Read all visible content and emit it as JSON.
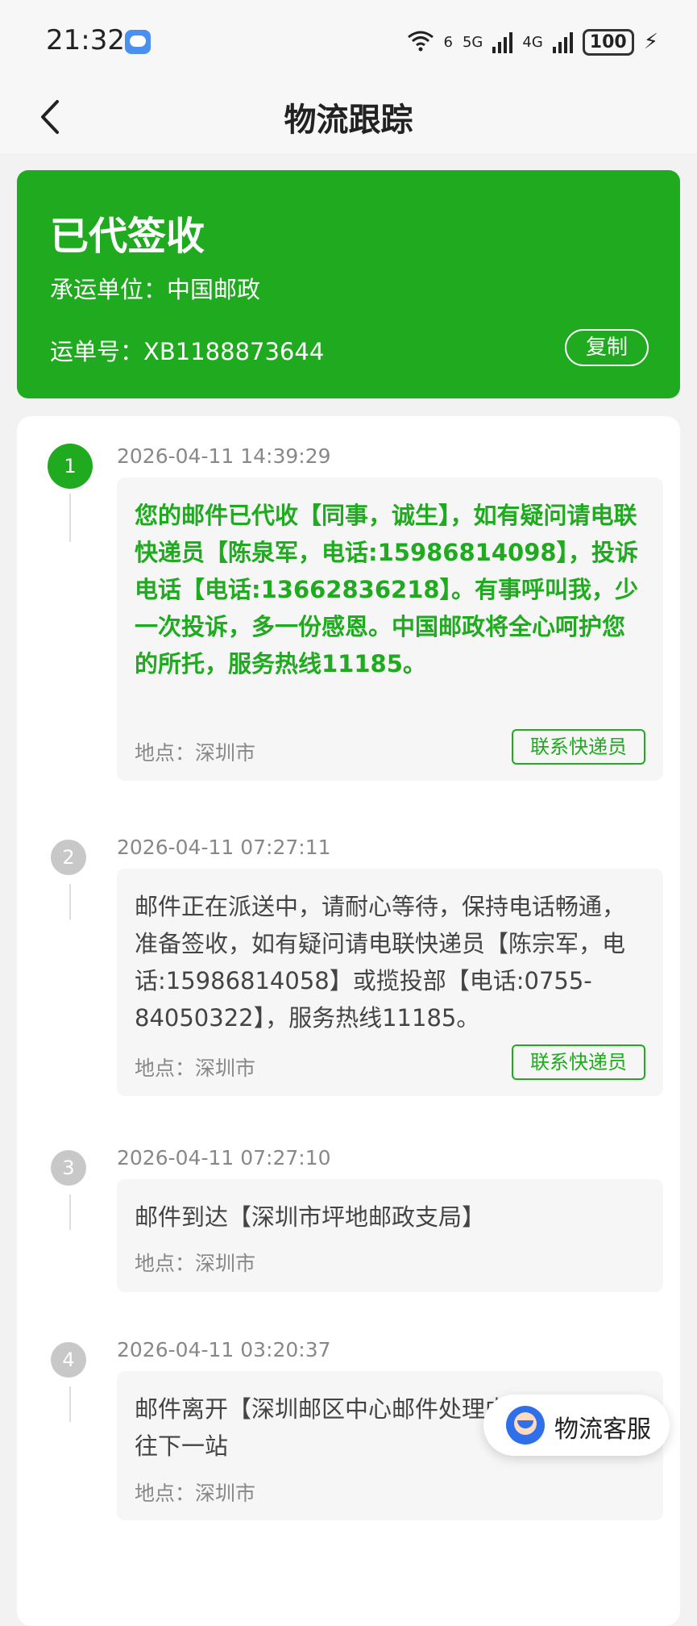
{
  "status_bar": {
    "time": "21:32",
    "network_labels": [
      "6",
      "5G",
      "4G"
    ],
    "battery": "100"
  },
  "header": {
    "title": "物流跟踪"
  },
  "summary": {
    "status": "已代签收",
    "carrier_label": "承运单位：中国邮政",
    "waybill_label": "运单号：XB11",
    "waybill_tail": "88873644",
    "copy_button": "复制"
  },
  "timeline": [
    {
      "step": "1",
      "time": "2026-04-11 14:39:29",
      "description": "您的邮件已代收【同事，诚生】，如有疑问请电联快递员【陈泉军，电话:15986814098】，投诉电话【电话:13662836218】。有事呼叫我，少一次投诉，多一份感恩。中国邮政将全心呵护您的所托，服务热线11185。",
      "location": "地点：深圳市",
      "action": "联系快递员"
    },
    {
      "step": "2",
      "time": "2026-04-11 07:27:11",
      "description": "邮件正在派送中，请耐心等待，保持电话畅通，准备签收，如有疑问请电联快递员【陈宗军，电话:15986814058】或揽投部【电话:0755-84050322】，服务热线11185。",
      "location": "地点：深圳市",
      "action": "联系快递员"
    },
    {
      "step": "3",
      "time": "2026-04-11 07:27:10",
      "description": "邮件到达【深圳市坪地邮政支局】",
      "location": "地点：深圳市"
    },
    {
      "step": "4",
      "time": "2026-04-11 03:20:37",
      "description": "邮件离开【深圳邮区中心邮件处理中心】，正在发往下一站",
      "location": "地点：深圳市"
    }
  ],
  "fab": {
    "label": "物流客服"
  },
  "colors": {
    "brand": "#1faa1f",
    "inactive_step": "#c8c8c8"
  }
}
